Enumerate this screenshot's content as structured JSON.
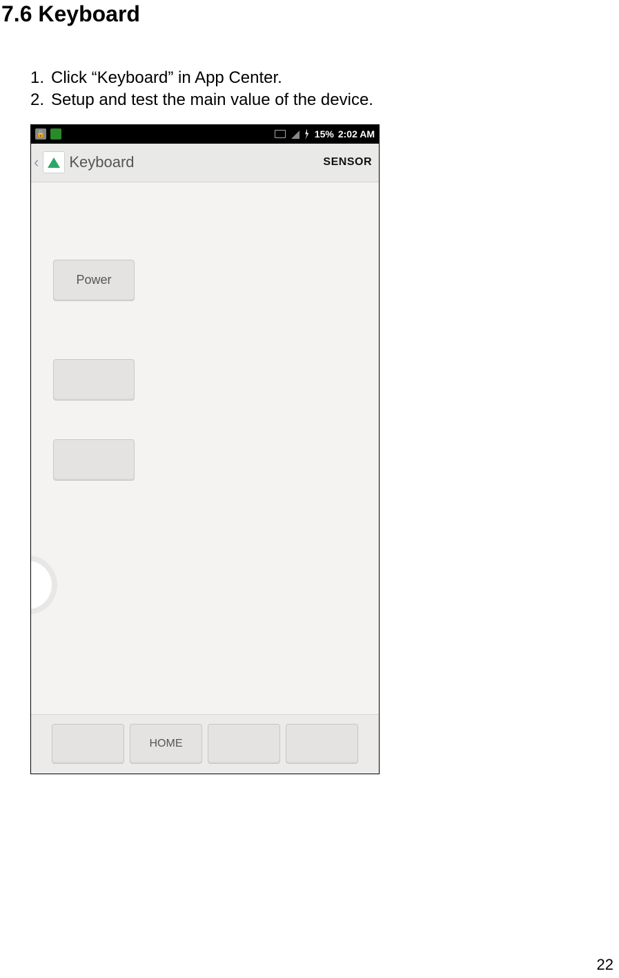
{
  "heading": "7.6 Keyboard",
  "steps": [
    {
      "num": "1.",
      "text": "Click “Keyboard” in App Center."
    },
    {
      "num": "2.",
      "text": "Setup and test the main value of the device."
    }
  ],
  "phone": {
    "statusbar": {
      "battery_pct": "15%",
      "time": "2:02 AM"
    },
    "header": {
      "title": "Keyboard",
      "sensor_label": "SENSOR"
    },
    "buttons": {
      "power": "Power",
      "blank1": "",
      "blank2": ""
    },
    "nav": {
      "b1": "",
      "home": "HOME",
      "b3": "",
      "b4": ""
    }
  },
  "page_number": "22"
}
